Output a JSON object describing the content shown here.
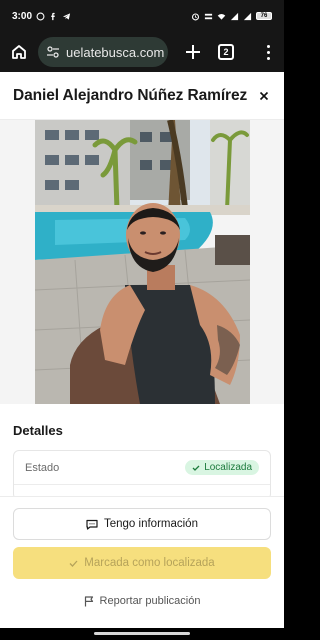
{
  "status_bar": {
    "time": "3:00",
    "battery": "76"
  },
  "browser": {
    "url": "uelatebusca.com",
    "tab_count": "2"
  },
  "modal": {
    "title": "Daniel Alejandro Núñez Ramírez"
  },
  "details": {
    "heading": "Detalles",
    "rows": [
      {
        "label": "Estado",
        "badge": "Localizada"
      }
    ]
  },
  "actions": {
    "info_button": "Tengo información",
    "marked_button": "Marcada como localizada",
    "report_link": "Reportar publicación"
  },
  "colors": {
    "badge_bg": "#d9f5e2",
    "badge_text": "#1c7a3c",
    "marked_bg": "#f6df7e"
  }
}
